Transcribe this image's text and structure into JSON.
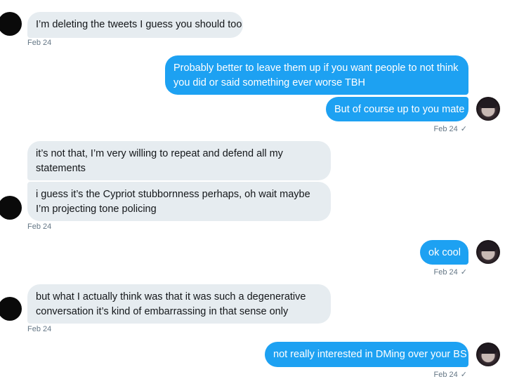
{
  "messages": [
    {
      "text": "I’m deleting the tweets I guess you should too"
    },
    {
      "text": "Probably better to leave them up if you want people to not think you did or said something ever worse TBH"
    },
    {
      "text": "But of course up to you mate"
    },
    {
      "text": "it’s not that, I’m very willing to repeat and defend all my statements"
    },
    {
      "text": "i guess it’s the Cypriot stubbornness perhaps, oh wait maybe I’m projecting tone policing"
    },
    {
      "text": "ok cool"
    },
    {
      "text": "but what I actually think was that it was such a degenerative conversation it’s kind of embarrassing in that sense only"
    },
    {
      "text": "not really interested in DMing over your BS"
    }
  ],
  "timestamps": {
    "t1": "Feb 24",
    "t2": "Feb 24",
    "t3": "Feb 24",
    "t4": "Feb 24",
    "t5": "Feb 24",
    "t6": "Feb 24",
    "t7": "Feb 24"
  },
  "read_receipt_icon": "checkmark-icon",
  "read_receipt_glyph": "✓",
  "colors": {
    "outgoing_bubble": "#1da1f2",
    "incoming_bubble": "#e6ecf0",
    "timestamp": "#657786"
  }
}
